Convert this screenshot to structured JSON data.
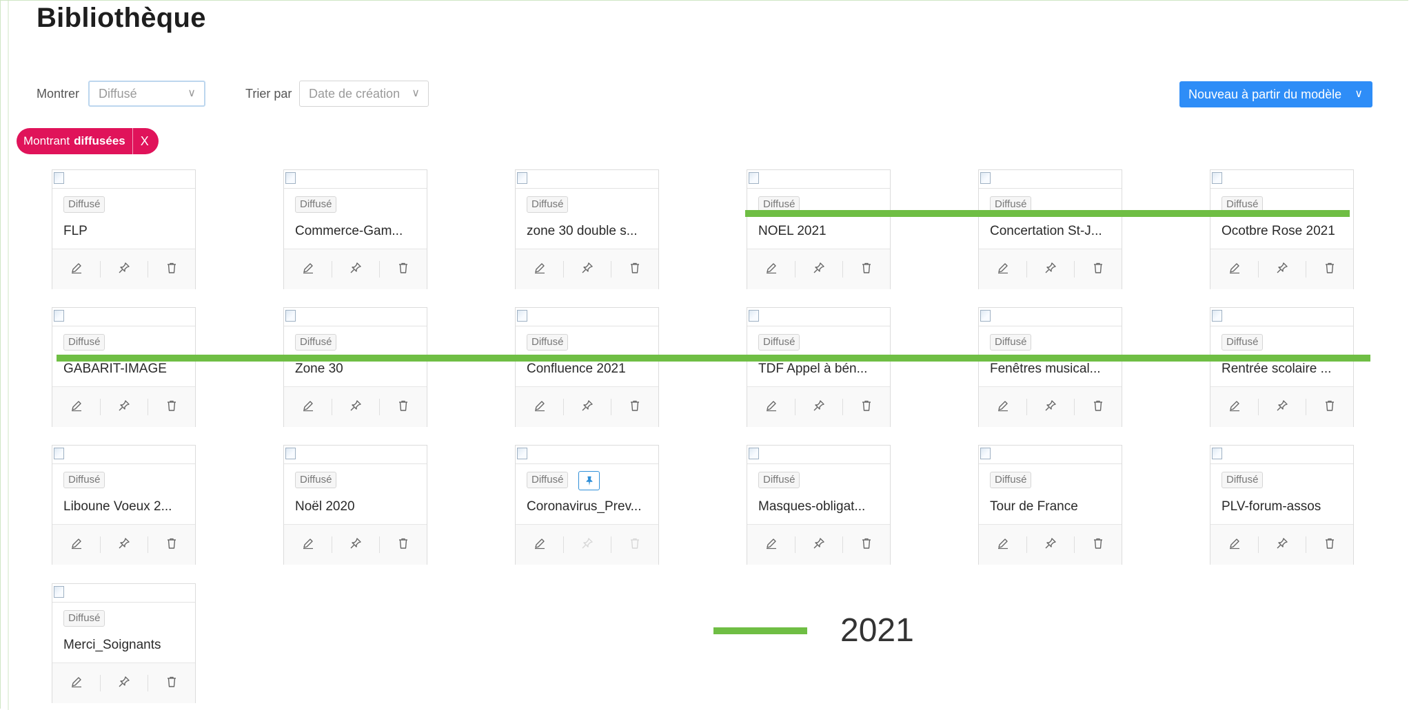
{
  "page": {
    "title": "Bibliothèque"
  },
  "filters": {
    "show_label": "Montrer",
    "show_value": "Diffusé",
    "sort_label": "Trier par",
    "sort_value": "Date de création",
    "new_button": "Nouveau à partir du modèle",
    "chevron": "∨"
  },
  "active_filter": {
    "prefix": "Montrant",
    "value": "diffusées",
    "close": "X"
  },
  "cards": [
    {
      "badge": "Diffusé",
      "name": "FLP"
    },
    {
      "badge": "Diffusé",
      "name": "Commerce-Gam..."
    },
    {
      "badge": "Diffusé",
      "name": "zone 30 double s..."
    },
    {
      "badge": "Diffusé",
      "name": "NOEL 2021"
    },
    {
      "badge": "Diffusé",
      "name": "Concertation St-J..."
    },
    {
      "badge": "Diffusé",
      "name": "Ocotbre Rose 2021"
    },
    {
      "badge": "Diffusé",
      "name": "GABARIT-IMAGE"
    },
    {
      "badge": "Diffusé",
      "name": "Zone 30"
    },
    {
      "badge": "Diffusé",
      "name": "Confluence 2021"
    },
    {
      "badge": "Diffusé",
      "name": "TDF Appel à bén..."
    },
    {
      "badge": "Diffusé",
      "name": "Fenêtres musical..."
    },
    {
      "badge": "Diffusé",
      "name": "Rentrée scolaire ..."
    },
    {
      "badge": "Diffusé",
      "name": "Liboune Voeux 2..."
    },
    {
      "badge": "Diffusé",
      "name": "Noël 2020"
    },
    {
      "badge": "Diffusé",
      "name": "Coronavirus_Prev...",
      "pinned": true
    },
    {
      "badge": "Diffusé",
      "name": "Masques-obligat..."
    },
    {
      "badge": "Diffusé",
      "name": "Tour de France"
    },
    {
      "badge": "Diffusé",
      "name": "PLV-forum-assos"
    },
    {
      "badge": "Diffusé",
      "name": "Merci_Soignants"
    }
  ],
  "legend": {
    "label": "2021",
    "color": "#6fbe44"
  },
  "colors": {
    "accent": "#2e8df7",
    "filter_tag": "#e0135a",
    "highlight": "#6fbe44"
  }
}
